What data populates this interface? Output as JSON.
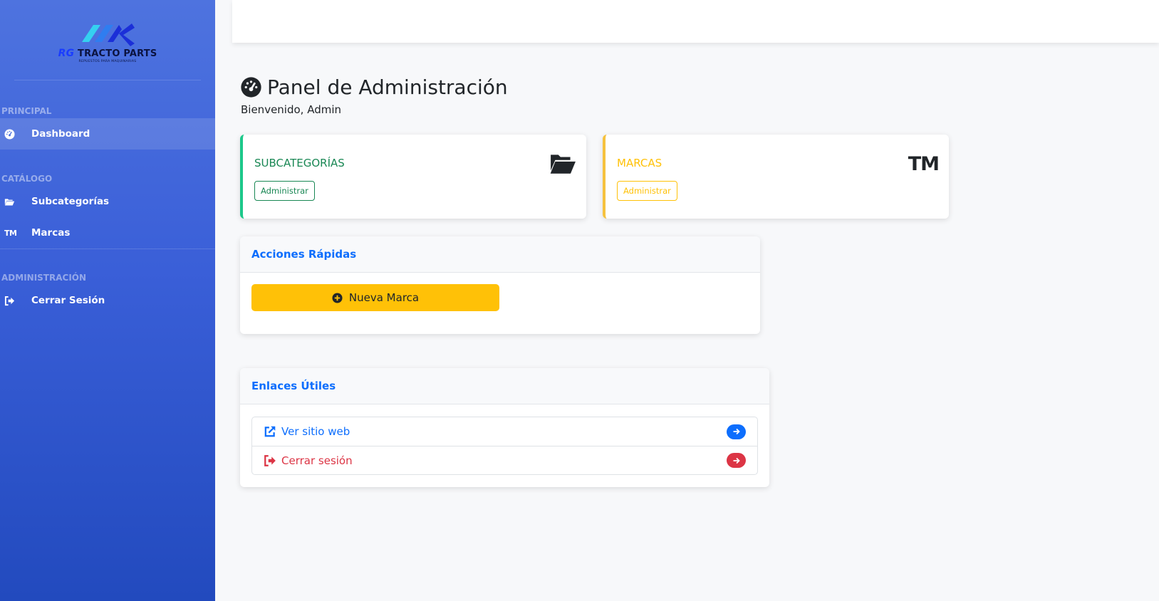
{
  "brand": {
    "logo_rg": "RG",
    "logo_name": "TRACTO PARTS",
    "logo_tagline": "REPUESTOS PARA MAQUINARIAS"
  },
  "sidebar": {
    "sections": [
      {
        "label": "PRINCIPAL"
      },
      {
        "label": "CATÁLOGO"
      },
      {
        "label": "ADMINISTRACIÓN"
      }
    ],
    "items": [
      {
        "label": "Dashboard",
        "icon": "tachometer-icon",
        "active": true
      },
      {
        "label": "Subcategorías",
        "icon": "folder-open-icon"
      },
      {
        "label": "Marcas",
        "icon_text": "TM"
      },
      {
        "label": "Cerrar Sesión",
        "icon": "sign-out-icon"
      }
    ]
  },
  "header": {
    "title": "Panel de Administración",
    "welcome": "Bienvenido, Admin"
  },
  "cards": [
    {
      "title": "SUBCATEGORÍAS",
      "button": "Administrar",
      "icon": "folder-open-icon",
      "accent": "#1cc88a"
    },
    {
      "title": "MARCAS",
      "button": "Administrar",
      "icon_text": "TM",
      "accent": "#f6c23e"
    }
  ],
  "quick_actions": {
    "title": "Acciones Rápidas",
    "new_brand_label": "Nueva Marca"
  },
  "useful_links": {
    "title": "Enlaces Útiles",
    "items": [
      {
        "label": "Ver sitio web",
        "icon": "external-link-icon",
        "color": "#0d6efd"
      },
      {
        "label": "Cerrar sesión",
        "icon": "sign-out-icon",
        "color": "#dc3545"
      }
    ]
  },
  "colors": {
    "sidebar_top": "#4e73df",
    "sidebar_bottom": "#224abe",
    "primary": "#0d6efd",
    "warning": "#ffc107",
    "success": "#198754",
    "danger": "#dc3545"
  }
}
